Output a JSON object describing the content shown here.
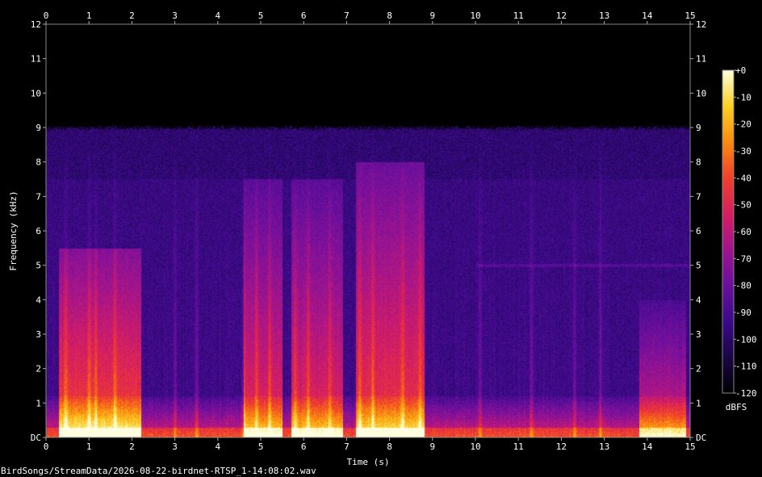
{
  "chart_data": {
    "type": "heatmap",
    "title": "",
    "xlabel": "Time (s)",
    "ylabel": "Frequency (kHz)",
    "xlim": [
      0,
      15
    ],
    "ylim": [
      0,
      12
    ],
    "x_ticks": [
      "0",
      "1",
      "2",
      "3",
      "4",
      "5",
      "6",
      "7",
      "8",
      "9",
      "10",
      "11",
      "12",
      "13",
      "14",
      "15"
    ],
    "y_ticks": [
      "DC",
      "1",
      "2",
      "3",
      "4",
      "5",
      "6",
      "7",
      "8",
      "9",
      "10",
      "11",
      "12"
    ],
    "colorbar": {
      "label": "dBFS",
      "ticks": [
        "+0",
        "-10",
        "-20",
        "-30",
        "-40",
        "-50",
        "-60",
        "-70",
        "-80",
        "-90",
        "-100",
        "-110",
        "-120"
      ],
      "range": [
        -120,
        0
      ]
    },
    "colormap": [
      "#000000",
      "#1a0545",
      "#3a0a8a",
      "#6a0f9e",
      "#a0148e",
      "#d81e60",
      "#f0402a",
      "#fb8a10",
      "#fdd023",
      "#ffffe0"
    ],
    "background_level_dbfs": -95,
    "cutoff_khz": 9.0,
    "transients_s": [
      0.45,
      1.0,
      1.15,
      1.6,
      3.0,
      3.5,
      4.6,
      4.9,
      5.2,
      5.8,
      6.1,
      6.6,
      7.3,
      7.6,
      8.3,
      8.7,
      10.1,
      11.3,
      12.3,
      12.9
    ],
    "energetic_regions": [
      {
        "t": [
          0.3,
          2.2
        ],
        "f_max_khz": 5.5,
        "peak_dbfs": -40
      },
      {
        "t": [
          4.6,
          5.5
        ],
        "f_max_khz": 7.5,
        "peak_dbfs": -50
      },
      {
        "t": [
          5.7,
          6.9
        ],
        "f_max_khz": 7.5,
        "peak_dbfs": -50
      },
      {
        "t": [
          7.2,
          8.8
        ],
        "f_max_khz": 8.0,
        "peak_dbfs": -45
      },
      {
        "t": [
          13.8,
          14.9
        ],
        "f_max_khz": 4.0,
        "peak_dbfs": -55
      }
    ]
  },
  "footer": {
    "filename": "BirdSongs/StreamData/2026-08-22-birdnet-RTSP_1-14:08:02.wav"
  }
}
